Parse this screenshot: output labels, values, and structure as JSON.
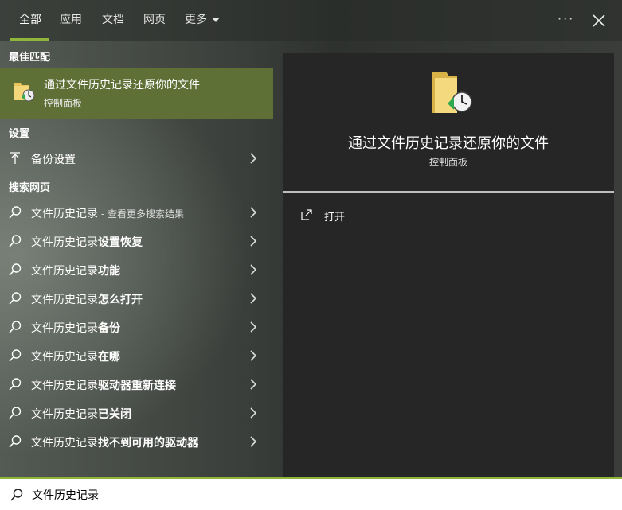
{
  "tabs": [
    {
      "label": "全部",
      "active": true
    },
    {
      "label": "应用"
    },
    {
      "label": "文档"
    },
    {
      "label": "网页"
    },
    {
      "label": "更多"
    }
  ],
  "window": {
    "more_icon": "more-dots-icon",
    "close_icon": "close-icon"
  },
  "sections": {
    "best_match": "最佳匹配",
    "settings": "设置",
    "web": "搜索网页"
  },
  "best_match": {
    "title": "通过文件历史记录还原你的文件",
    "subtitle": "控制面板",
    "icon": "file-history-folder-icon"
  },
  "settings_items": [
    {
      "label": "备份设置",
      "icon": "backup-arrow-icon"
    }
  ],
  "web_items": [
    {
      "prefix": "文件历史记录",
      "bold": "",
      "hint": " - 查看更多搜索结果"
    },
    {
      "prefix": "文件历史记录",
      "bold": "设置恢复",
      "hint": ""
    },
    {
      "prefix": "文件历史记录",
      "bold": "功能",
      "hint": ""
    },
    {
      "prefix": "文件历史记录",
      "bold": "怎么打开",
      "hint": ""
    },
    {
      "prefix": "文件历史记录",
      "bold": "备份",
      "hint": ""
    },
    {
      "prefix": "文件历史记录",
      "bold": "在哪",
      "hint": ""
    },
    {
      "prefix": "文件历史记录",
      "bold": "驱动器重新连接",
      "hint": ""
    },
    {
      "prefix": "文件历史记录",
      "bold": "已关闭",
      "hint": ""
    },
    {
      "prefix": "文件历史记录",
      "bold": "找不到可用的驱动器",
      "hint": ""
    }
  ],
  "preview": {
    "title": "通过文件历史记录还原你的文件",
    "subtitle": "控制面板",
    "action_label": "打开"
  },
  "search": {
    "value": "文件历史记录"
  },
  "colors": {
    "accent": "#8fb53a",
    "selected_row": "#5f7036"
  }
}
